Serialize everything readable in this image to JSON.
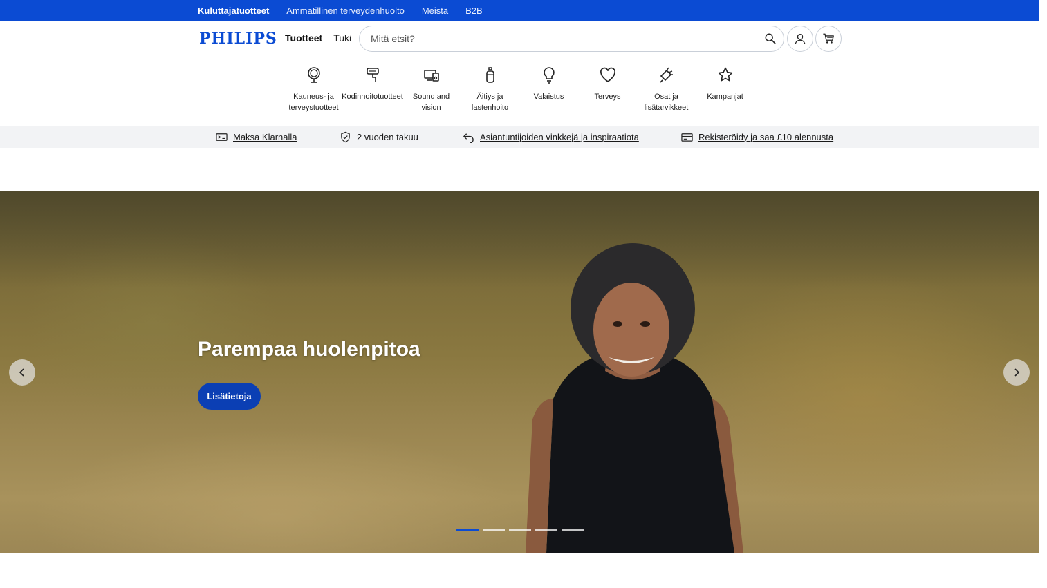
{
  "topbar": {
    "links": [
      "Kuluttajatuotteet",
      "Ammatillinen terveydenhuolto",
      "Meistä",
      "B2B"
    ]
  },
  "header": {
    "logo": "PHILIPS",
    "nav": [
      "Tuotteet",
      "Tuki"
    ],
    "search_placeholder": "Mitä etsit?"
  },
  "categories": [
    {
      "label": "Kauneus- ja\nterveystuotteet",
      "icon": "mirror-icon"
    },
    {
      "label": "Kodinhoitotuotteet",
      "icon": "iron-icon"
    },
    {
      "label": "Sound and\nvision",
      "icon": "devices-icon"
    },
    {
      "label": "Äitiys ja\nlastenhoito",
      "icon": "bottle-icon"
    },
    {
      "label": "Valaistus",
      "icon": "bulb-icon"
    },
    {
      "label": "Terveys",
      "icon": "heart-icon"
    },
    {
      "label": "Osat ja\nlisätarvikkeet",
      "icon": "brush-icon"
    },
    {
      "label": "Kampanjat",
      "icon": "star-icon"
    }
  ],
  "usp": [
    {
      "text": "Maksa Klarnalla",
      "icon": "ticket-icon"
    },
    {
      "text": "2 vuoden takuu",
      "icon": "shield-icon"
    },
    {
      "text": "Asiantuntijoiden vinkkejä ja inspiraatiota",
      "icon": "return-icon"
    },
    {
      "text": "Rekisteröidy ja saa £10 alennusta",
      "icon": "card-icon"
    }
  ],
  "hero": {
    "title": "Parempaa huolenpitoa",
    "cta": "Lisätietoja",
    "slides_total": 5,
    "active_slide": 1
  },
  "colors": {
    "brand_blue": "#0b4bd3",
    "cta_blue": "#0b3fb4",
    "usp_bg": "#f2f3f5"
  }
}
